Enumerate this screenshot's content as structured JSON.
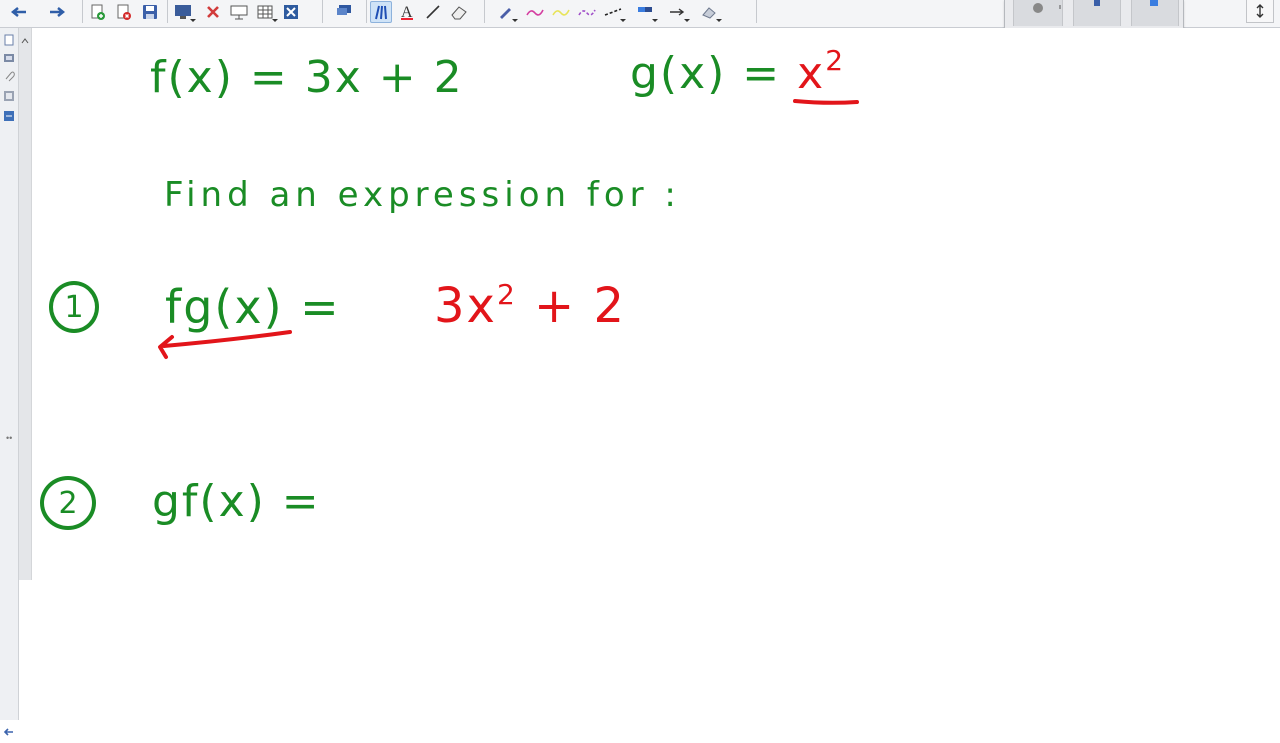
{
  "canvas": {
    "f_def": "f(x) = 3x + 2",
    "g_def_left": "g(x) = ",
    "g_def_right": "x",
    "g_def_exp": "2",
    "prompt": "Find an expression for :",
    "q1": {
      "number": "1",
      "label": "fg(x) = ",
      "answer_base": "3x",
      "answer_exp": "2",
      "answer_tail": " + 2"
    },
    "q2": {
      "number": "2",
      "label": "gf(x) = "
    }
  },
  "colors": {
    "green_ink": "#1a8c25",
    "red_ink": "#e2151a",
    "toolbar_bg": "#f4f5f7"
  },
  "toolbar": {
    "icons": [
      "back-arrow-icon",
      "forward-arrow-icon",
      "add-page-icon",
      "delete-page-icon",
      "save-icon",
      "screen-shade-icon",
      "delete-icon",
      "display-icon",
      "table-icon",
      "close-box-icon",
      "capture-icon",
      "pens-icon",
      "text-icon",
      "line-icon",
      "eraser-icon",
      "pen-color-icon",
      "magic-pen-icon",
      "highlighter-icon",
      "creative-pen-icon",
      "dashed-line-icon",
      "fill-icon",
      "arrow-tool-icon",
      "shape-icon"
    ]
  },
  "side_tabs": [
    "page-sorter-icon",
    "gallery-icon",
    "attachments-icon",
    "properties-icon",
    "addons-icon"
  ]
}
